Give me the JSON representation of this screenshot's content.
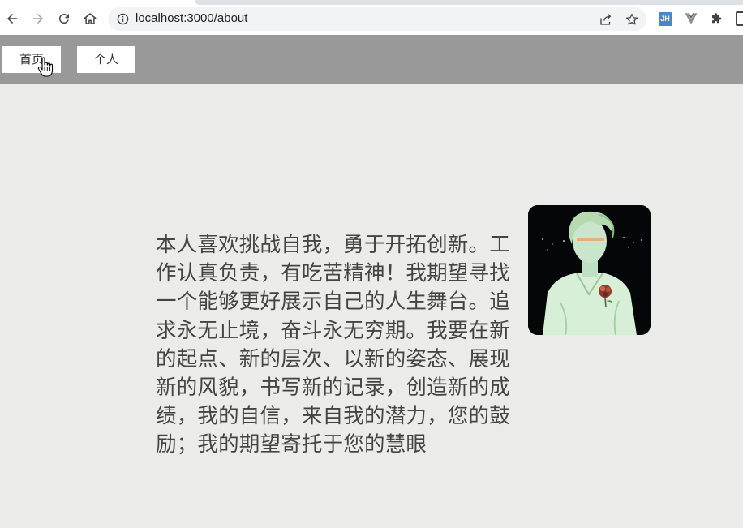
{
  "browser": {
    "url": "localhost:3000/about",
    "extension_badge": "JH"
  },
  "nav": {
    "items": [
      {
        "label": "首页"
      },
      {
        "label": "个人"
      }
    ]
  },
  "main": {
    "intro_text": "本人喜欢挑战自我，勇于开拓创新。工作认真负责，有吃苦精神！我期望寻找一个能够更好展示自己的人生舞台。追求永无止境，奋斗永无穷期。我要在新的起点、新的层次、以新的姿态、展现新的风貌，书写新的记录，创造新的成绩，我的自信，来自我的潜力，您的鼓励；我的期望寄托于您的慧眼"
  },
  "icons": {
    "back": "arrow-left-icon",
    "forward": "arrow-right-icon",
    "reload": "reload-icon",
    "home": "home-icon",
    "info": "info-icon",
    "share": "share-icon",
    "bookmark": "star-icon",
    "vue_devtools": "vue-icon",
    "extensions": "puzzle-icon",
    "cursor": "hand-pointer-icon"
  },
  "colors": {
    "nav_bar": "#999999",
    "page_bg": "#ebebe9",
    "text": "#444444"
  }
}
